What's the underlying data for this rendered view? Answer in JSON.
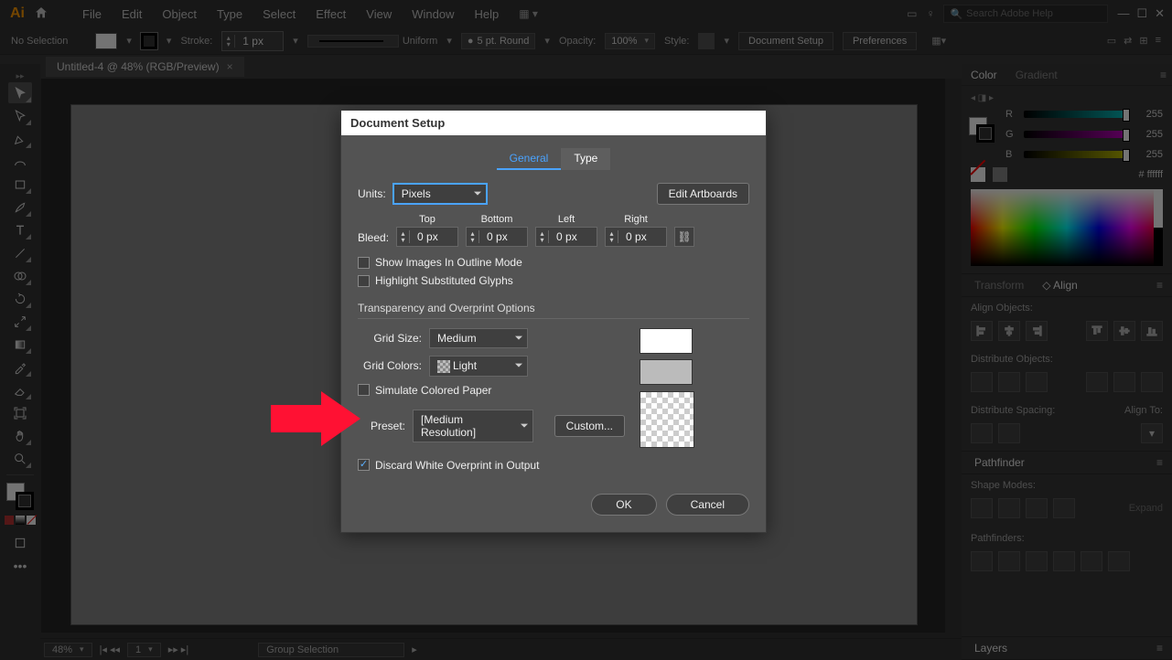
{
  "menubar": {
    "items": [
      "File",
      "Edit",
      "Object",
      "Type",
      "Select",
      "Effect",
      "View",
      "Window",
      "Help"
    ],
    "search_placeholder": "Search Adobe Help"
  },
  "controlbar": {
    "selection_label": "No Selection",
    "stroke_label": "Stroke:",
    "stroke_value": "1 px",
    "stroke_profile": "Uniform",
    "brush_label": "5 pt. Round",
    "opacity_label": "Opacity:",
    "opacity_value": "100%",
    "style_label": "Style:",
    "docsetup_btn": "Document Setup",
    "prefs_btn": "Preferences"
  },
  "tab": {
    "title": "Untitled-4 @ 48% (RGB/Preview)"
  },
  "panels": {
    "color_tab": "Color",
    "gradient_tab": "Gradient",
    "r": {
      "label": "R",
      "value": "255"
    },
    "g": {
      "label": "G",
      "value": "255"
    },
    "b": {
      "label": "B",
      "value": "255"
    },
    "hex_label": "#",
    "hex_value": "ffffff",
    "transform_tab": "Transform",
    "align_tab": "Align",
    "align_objects": "Align Objects:",
    "distribute_objects": "Distribute Objects:",
    "distribute_spacing": "Distribute Spacing:",
    "align_to": "Align To:",
    "pathfinder_tab": "Pathfinder",
    "shape_modes": "Shape Modes:",
    "pathfinders": "Pathfinders:",
    "expand": "Expand",
    "layers_tab": "Layers"
  },
  "statusbar": {
    "zoom": "48%",
    "artboard_index": "1",
    "tool": "Group Selection"
  },
  "dialog": {
    "title": "Document Setup",
    "tabs": {
      "general": "General",
      "type": "Type"
    },
    "units_label": "Units:",
    "units_value": "Pixels",
    "edit_artboards": "Edit Artboards",
    "bleed_label": "Bleed:",
    "bleed": {
      "top": {
        "hdr": "Top",
        "val": "0 px"
      },
      "bottom": {
        "hdr": "Bottom",
        "val": "0 px"
      },
      "left": {
        "hdr": "Left",
        "val": "0 px"
      },
      "right": {
        "hdr": "Right",
        "val": "0 px"
      }
    },
    "chk_outline": "Show Images In Outline Mode",
    "chk_glyphs": "Highlight Substituted Glyphs",
    "section_trans": "Transparency and Overprint Options",
    "grid_size_label": "Grid Size:",
    "grid_size_value": "Medium",
    "grid_colors_label": "Grid Colors:",
    "grid_colors_value": "Light",
    "chk_simulate": "Simulate Colored Paper",
    "preset_label": "Preset:",
    "preset_value": "[Medium Resolution]",
    "custom_btn": "Custom...",
    "chk_discard": "Discard White Overprint in Output",
    "ok": "OK",
    "cancel": "Cancel"
  }
}
